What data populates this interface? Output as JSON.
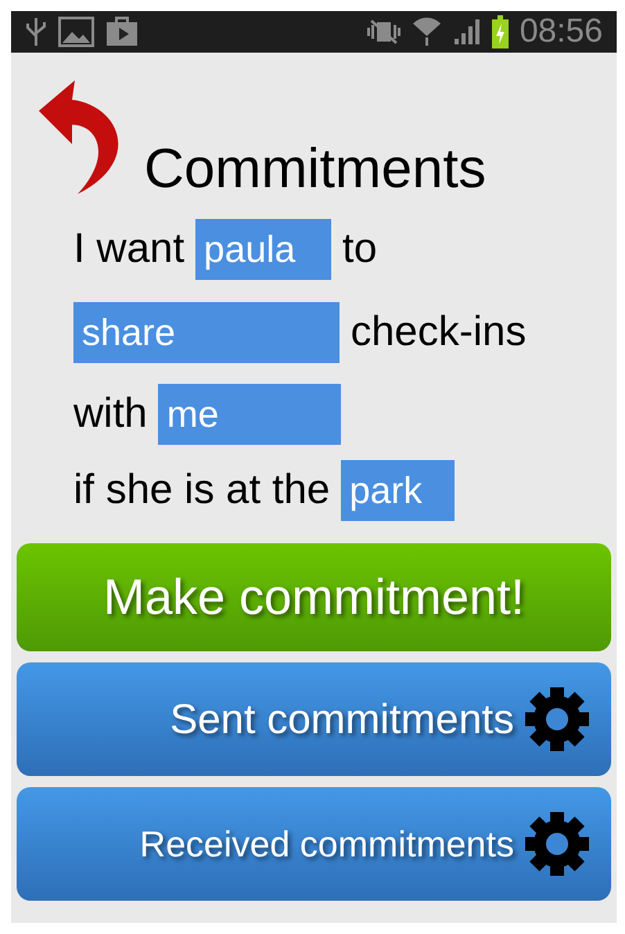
{
  "status_bar": {
    "time": "08:56"
  },
  "title": "Commitments",
  "lines": [
    {
      "parts": [
        {
          "kind": "text",
          "text": "I want"
        },
        {
          "kind": "field",
          "value": "paula"
        },
        {
          "kind": "text",
          "text": "to"
        }
      ]
    },
    {
      "parts": [
        {
          "kind": "field",
          "value": "share"
        },
        {
          "kind": "text",
          "text": "check-ins"
        }
      ]
    },
    {
      "parts": [
        {
          "kind": "text",
          "text": "with"
        },
        {
          "kind": "field",
          "value": "me"
        }
      ]
    },
    {
      "parts": [
        {
          "kind": "text",
          "text": "if she is at the"
        },
        {
          "kind": "field",
          "value": "park"
        }
      ]
    }
  ],
  "buttons": [
    {
      "kind": "primary",
      "label": "Make commitment!"
    },
    {
      "kind": "settings",
      "label": "Sent commitments"
    },
    {
      "kind": "settings",
      "label": "Received commitments"
    }
  ]
}
